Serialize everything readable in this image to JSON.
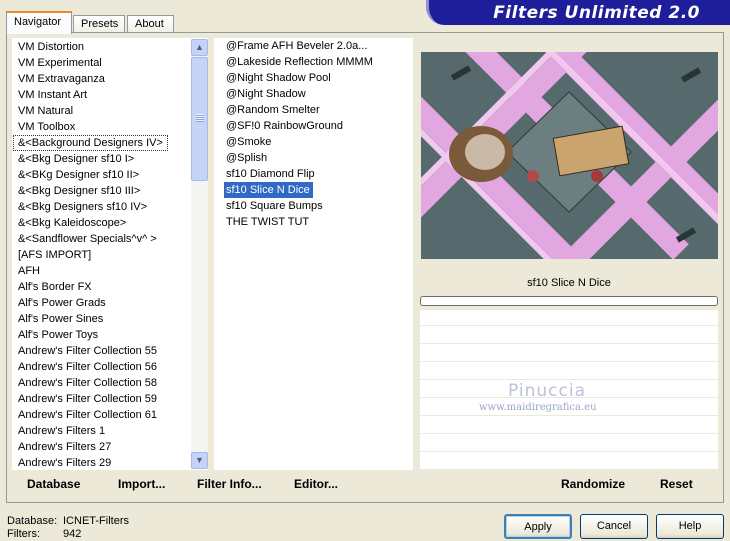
{
  "app": {
    "title": "Filters Unlimited 2.0"
  },
  "tabs": [
    {
      "label": "Navigator",
      "active": true
    },
    {
      "label": "Presets"
    },
    {
      "label": "About"
    }
  ],
  "categories": [
    "VM Distortion",
    "VM Experimental",
    "VM Extravaganza",
    "VM Instant Art",
    "VM Natural",
    "VM Toolbox",
    "&<Background Designers IV>",
    "&<Bkg Designer sf10 I>",
    "&<BKg Designer sf10 II>",
    "&<Bkg Designer sf10 III>",
    "&<Bkg Designers sf10 IV>",
    "&<Bkg Kaleidoscope>",
    "&<Sandflower Specials^v^ >",
    "[AFS IMPORT]",
    "AFH",
    "Alf's Border FX",
    "Alf's Power Grads",
    "Alf's Power Sines",
    "Alf's Power Toys",
    "Andrew's Filter Collection 55",
    "Andrew's Filter Collection 56",
    "Andrew's Filter Collection 58",
    "Andrew's Filter Collection 59",
    "Andrew's Filter Collection 61",
    "Andrew's Filters 1",
    "Andrew's Filters 27",
    "Andrew's Filters 29"
  ],
  "categories_focused_index": 6,
  "filters": [
    "@Frame AFH Beveler 2.0a...",
    "@Lakeside Reflection MMMM",
    "@Night Shadow Pool",
    "@Night Shadow",
    "@Random Smelter",
    "@SF!0 RainbowGround",
    "@Smoke",
    "@Splish",
    "sf10 Diamond Flip",
    "sf10 Slice N Dice",
    "sf10 Square Bumps",
    "THE TWIST TUT"
  ],
  "filters_selected_index": 9,
  "preview": {
    "filter_name": "sf10 Slice N Dice"
  },
  "watermark": {
    "line1": "Pinuccia",
    "line2": "www.maidiregrafica.eu"
  },
  "bottom_links": {
    "database": "Database",
    "import": "Import...",
    "filter_info": "Filter Info...",
    "editor": "Editor...",
    "randomize": "Randomize",
    "reset": "Reset"
  },
  "status": {
    "database_label": "Database:",
    "database_value": "ICNET-Filters",
    "filters_label": "Filters:",
    "filters_value": "942"
  },
  "buttons": {
    "apply": "Apply",
    "cancel": "Cancel",
    "help": "Help"
  },
  "colors": {
    "banner": "#1e1e9a",
    "selection": "#316ac5",
    "background": "#ece9d8"
  }
}
